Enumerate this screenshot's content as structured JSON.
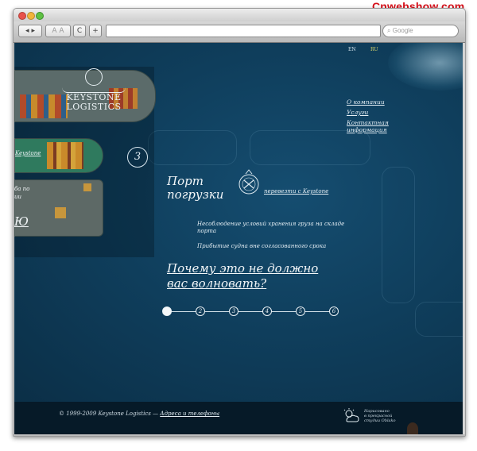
{
  "watermark": "Cnwebshow.com",
  "browser": {
    "back_label": "◂",
    "forward_label": "▸",
    "text_size_label": "A A",
    "reload_label": "C",
    "add_label": "+",
    "search_placeholder": "Google"
  },
  "lang": {
    "en": "EN",
    "ru": "RU"
  },
  "logo": {
    "line1": "KEYSTONE",
    "line2": "LOGISTICS"
  },
  "ship_label": "Keystone",
  "left_cut_text": {
    "line1": "ба по",
    "line2": "ии",
    "big": "Ю"
  },
  "nav": [
    {
      "label": "О компании"
    },
    {
      "label": "Услуги"
    },
    {
      "label": "Контактная"
    },
    {
      "label": "информация"
    }
  ],
  "step_number": "3",
  "port": {
    "line1": "Порт",
    "line2": "погрузки"
  },
  "transfer_link": "перевезти с Keystone",
  "risks": [
    {
      "line1": "Несоблюдение условий хранения груза на складе",
      "line2": "порта"
    },
    {
      "line1": "Прибытие судна вне согласованного срока",
      "line2": ""
    }
  ],
  "why": {
    "line1": "Почему это не должно",
    "line2": "вас волновать?"
  },
  "timeline": [
    "",
    "2",
    "3",
    "4",
    "5",
    "6"
  ],
  "timeline_active": 3,
  "footer": {
    "copyright": "© 1999-2009 Keystone Logistics —",
    "contacts_link": "Адреса и телефоны",
    "studio_line1": "Нарисовано",
    "studio_line2": "в прекрасной",
    "studio_line3": "студии Oblako"
  },
  "colors": {
    "sea": "#0e3a57",
    "footer": "#061a28",
    "accent_text": "#e4eef4",
    "watermark": "#d6101a"
  }
}
